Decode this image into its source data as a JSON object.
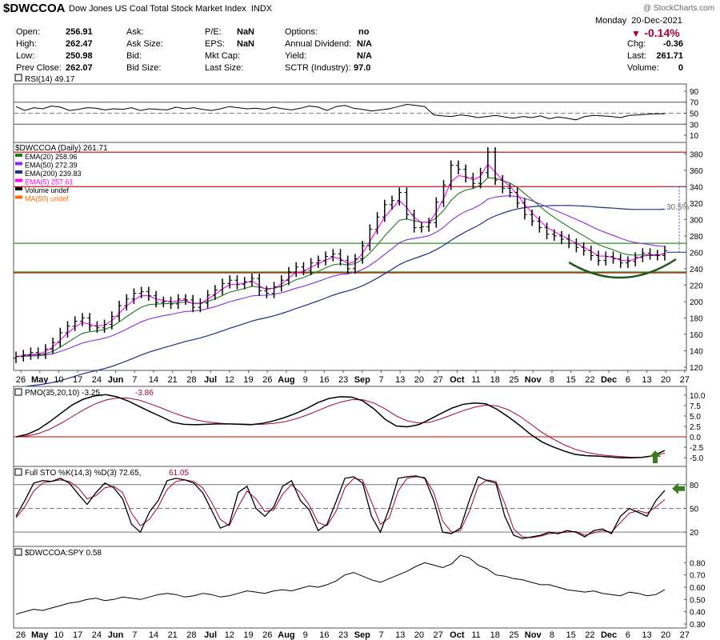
{
  "header": {
    "ticker": "$DWCCOA",
    "name": "Dow Jones US Coal Total Stock Market Index",
    "exchange": "INDX",
    "day": "Monday",
    "date": "20-Dec-2021",
    "pct_change": "-0.14%",
    "watermark": "@ StockCharts.com",
    "quote": {
      "open_label": "Open:",
      "open": "256.91",
      "high_label": "High:",
      "high": "262.47",
      "low_label": "Low:",
      "low": "250.98",
      "prev_label": "Prev Close:",
      "prev": "262.07",
      "ask_label": "Ask:",
      "ask_size_label": "Ask Size:",
      "bid_label": "Bid:",
      "bid_size_label": "Bid Size:",
      "pe_label": "P/E:",
      "pe": "NaN",
      "eps_label": "EPS:",
      "eps": "NaN",
      "mktcap_label": "Mkt Cap:",
      "lastsize_label": "Last Size:",
      "options_label": "Options:",
      "options": "no",
      "div_label": "Annual Dividend:",
      "div": "N/A",
      "yield_label": "Yield:",
      "yield": "N/A",
      "sctr_label": "SCTR (Industry):",
      "sctr": "97.0",
      "chg_label": "Chg:",
      "chg": "-0.36",
      "last_label": "Last:",
      "last": "261.71",
      "volume_label": "Volume:",
      "volume": "0"
    }
  },
  "chart_data": [
    {
      "type": "line",
      "panel": "rsi",
      "legend": "RSI(14) 49.17",
      "ylim": [
        0,
        100
      ],
      "ticks": [
        "90",
        "70",
        "50",
        "30",
        "10"
      ],
      "tick_values": [
        90,
        70,
        50,
        30,
        10
      ],
      "series": [
        {
          "name": "RSI(14)",
          "values": [
            62,
            55,
            60,
            58,
            63,
            61,
            55,
            57,
            60,
            59,
            56,
            58,
            57,
            60,
            55,
            58,
            57,
            56,
            61,
            58,
            60,
            57,
            55,
            58,
            62,
            60,
            58,
            59,
            57,
            61,
            58,
            56,
            59,
            63,
            61,
            55,
            62,
            64,
            59,
            57,
            54,
            56,
            58,
            62,
            66,
            64,
            62,
            47,
            45,
            44,
            47,
            45,
            42,
            44,
            46,
            43,
            41,
            44,
            42,
            45,
            40,
            43,
            41,
            38,
            44,
            46,
            45,
            44,
            42,
            46,
            47,
            48,
            49,
            49
          ]
        }
      ]
    },
    {
      "type": "candlestick",
      "panel": "price",
      "title": "$DWCCOA (Daily) 261.71",
      "ylim": [
        120,
        390
      ],
      "ticks": [
        "380",
        "360",
        "340",
        "320",
        "300",
        "280",
        "260",
        "240",
        "220",
        "200",
        "180",
        "160",
        "140",
        "120"
      ],
      "tick_values": [
        380,
        360,
        340,
        320,
        300,
        280,
        260,
        240,
        220,
        200,
        180,
        160,
        140,
        120
      ],
      "x_labels": [
        "26",
        "May",
        "10",
        "17",
        "24",
        "Jun",
        "7",
        "14",
        "21",
        "28",
        "Jul",
        "12",
        "19",
        "26",
        "Aug",
        "9",
        "16",
        "23",
        "Sep",
        "7",
        "13",
        "20",
        "27",
        "Oct",
        "11",
        "18",
        "25",
        "Nov",
        "8",
        "15",
        "22",
        "Dec",
        "6",
        "13",
        "20",
        "27"
      ],
      "x_label_weeks": [
        0,
        1,
        2,
        3,
        4,
        5,
        6,
        7,
        8,
        9,
        10,
        11,
        12,
        13,
        14,
        15,
        16,
        17,
        18,
        19,
        20,
        21,
        22,
        23,
        24,
        25,
        26,
        27,
        28,
        29,
        30,
        31,
        32,
        33,
        34,
        35
      ],
      "x_label_bold": [
        "May",
        "Jun",
        "Jul",
        "Aug",
        "Sep",
        "Oct",
        "Nov",
        "Dec"
      ],
      "close": [
        133,
        135,
        138,
        136,
        142,
        150,
        162,
        170,
        176,
        180,
        170,
        168,
        172,
        182,
        195,
        203,
        210,
        212,
        207,
        199,
        200,
        197,
        203,
        202,
        193,
        198,
        208,
        214,
        222,
        226,
        221,
        224,
        228,
        213,
        210,
        218,
        226,
        236,
        242,
        238,
        247,
        250,
        255,
        258,
        250,
        240,
        252,
        268,
        288,
        303,
        318,
        323,
        333,
        306,
        290,
        291,
        296,
        321,
        342,
        366,
        361,
        351,
        344,
        357,
        382,
        348,
        338,
        333,
        320,
        306,
        298,
        290,
        282,
        280,
        276,
        271,
        266,
        262,
        256,
        250,
        255,
        252,
        247,
        249,
        254,
        259,
        257,
        256,
        262
      ],
      "high_offset": 6,
      "low_offset": 6,
      "legend": [
        {
          "name": "EMA(20) 258.96",
          "color": "#1f7a1f"
        },
        {
          "name": "EMA(50) 272.39",
          "color": "#8a2be2"
        },
        {
          "name": "EMA(200) 239.83",
          "color": "#1f2f8a"
        },
        {
          "name": "EMA(5) 257.61",
          "color": "#ff00ff"
        },
        {
          "name": "Volume undef",
          "color": "#000000"
        },
        {
          "name": "MA(50) undef",
          "color": "#ff6a00"
        }
      ],
      "hlines": [
        {
          "value": 382,
          "color": "#cc0000"
        },
        {
          "value": 340,
          "color": "#cc0000"
        },
        {
          "value": 271,
          "color": "#cc0000"
        },
        {
          "value": 235,
          "color": "#cc0000"
        },
        {
          "value": 271,
          "color": "#1f9a1f"
        },
        {
          "value": 236,
          "color": "#1f9a1f"
        }
      ],
      "annotation": "30.5%",
      "projection": {
        "from": 260,
        "to": 340
      }
    },
    {
      "type": "line",
      "panel": "pmo",
      "legend_main": "PMO(35,20,10) -3.25,",
      "legend_signal": "-3.86",
      "ylim": [
        -6.5,
        11.5
      ],
      "ticks": [
        "10.0",
        "7.5",
        "5.0",
        "2.5",
        "0.0",
        "-2.5",
        "-5.0"
      ],
      "tick_values": [
        10,
        7.5,
        5,
        2.5,
        0,
        -2.5,
        -5
      ],
      "series": [
        {
          "name": "PMO",
          "color": "#000000",
          "values": [
            0,
            0.6,
            1.8,
            3.6,
            5.6,
            7.6,
            9,
            9.8,
            10.1,
            9.6,
            8.6,
            7.3,
            6,
            4.8,
            3.5,
            3,
            2.9,
            3,
            3.1,
            3.1,
            3,
            2.9,
            3.2,
            3.8,
            4.6,
            5.6,
            6.8,
            8.2,
            9.2,
            9.6,
            9.5,
            8.6,
            6.7,
            4.2,
            2.6,
            2.4,
            2.9,
            4.2,
            5.6,
            6.9,
            7.8,
            8.1,
            7.9,
            6.6,
            4.8,
            2.8,
            0.6,
            -1.2,
            -2.4,
            -3.4,
            -4.2,
            -4.5,
            -4.6,
            -4.8,
            -5.0,
            -5.0,
            -4.9,
            -4.5,
            -3.25
          ]
        },
        {
          "name": "Signal",
          "color": "#a8003a",
          "values": [
            0,
            0.2,
            0.8,
            1.8,
            3.2,
            4.8,
            6.4,
            7.8,
            8.8,
            9.3,
            9.3,
            8.8,
            7.9,
            6.9,
            5.8,
            4.9,
            4.1,
            3.6,
            3.3,
            3.1,
            3.1,
            3.0,
            3.0,
            3.2,
            3.6,
            4.3,
            5.2,
            6.3,
            7.4,
            8.3,
            8.9,
            8.9,
            8.1,
            6.7,
            5.0,
            3.8,
            3.3,
            3.5,
            4.3,
            5.3,
            6.3,
            7.1,
            7.6,
            7.4,
            6.5,
            5.0,
            3.1,
            1.1,
            -0.5,
            -1.9,
            -3.0,
            -3.7,
            -4.2,
            -4.5,
            -4.7,
            -4.9,
            -4.9,
            -4.6,
            -3.86
          ]
        }
      ],
      "hlines": [
        {
          "value": 0,
          "color": "#cc0000"
        }
      ]
    },
    {
      "type": "line",
      "panel": "sto",
      "legend_main": "Full STO %K(14,3) %D(3) 72.65,",
      "legend_signal": "61.05",
      "ylim": [
        5,
        100
      ],
      "ticks": [
        "80",
        "50",
        "20"
      ],
      "tick_values": [
        80,
        50,
        20
      ],
      "series": [
        {
          "name": "%K",
          "color": "#000000",
          "values": [
            40,
            60,
            82,
            85,
            84,
            88,
            82,
            68,
            55,
            70,
            82,
            76,
            62,
            30,
            20,
            45,
            60,
            85,
            88,
            86,
            82,
            70,
            48,
            25,
            30,
            70,
            78,
            50,
            40,
            52,
            78,
            85,
            60,
            48,
            22,
            30,
            58,
            88,
            90,
            82,
            40,
            20,
            50,
            88,
            90,
            91,
            88,
            60,
            20,
            18,
            25,
            60,
            90,
            85,
            82,
            40,
            16,
            12,
            14,
            16,
            20,
            18,
            22,
            20,
            14,
            22,
            24,
            18,
            40,
            50,
            45,
            40,
            60,
            72.65
          ]
        },
        {
          "name": "%D",
          "color": "#a8003a",
          "values": [
            38,
            52,
            72,
            82,
            84,
            86,
            84,
            76,
            62,
            66,
            76,
            78,
            70,
            44,
            28,
            36,
            52,
            74,
            84,
            86,
            84,
            76,
            58,
            36,
            28,
            52,
            72,
            62,
            46,
            48,
            68,
            80,
            70,
            54,
            32,
            28,
            46,
            76,
            88,
            86,
            58,
            30,
            38,
            72,
            88,
            90,
            89,
            70,
            34,
            20,
            22,
            46,
            78,
            86,
            84,
            56,
            24,
            14,
            13,
            15,
            18,
            19,
            20,
            21,
            16,
            19,
            22,
            20,
            32,
            44,
            47,
            44,
            52,
            61.05
          ]
        }
      ],
      "hlines": [
        {
          "value": 80
        },
        {
          "value": 50
        },
        {
          "value": 20
        }
      ]
    },
    {
      "type": "line",
      "panel": "relative",
      "legend": "$DWCCOA:SPY 0.58",
      "ylim": [
        0.28,
        0.92
      ],
      "ticks": [
        "0.80",
        "0.70",
        "0.60",
        "0.50",
        "0.40",
        "0.30"
      ],
      "tick_values": [
        0.8,
        0.7,
        0.6,
        0.5,
        0.4,
        0.3
      ],
      "series": [
        {
          "name": "$DWCCOA:SPY",
          "values": [
            0.38,
            0.4,
            0.42,
            0.41,
            0.43,
            0.45,
            0.47,
            0.48,
            0.5,
            0.51,
            0.49,
            0.5,
            0.52,
            0.51,
            0.5,
            0.52,
            0.54,
            0.55,
            0.54,
            0.52,
            0.53,
            0.55,
            0.54,
            0.52,
            0.53,
            0.55,
            0.57,
            0.56,
            0.55,
            0.57,
            0.58,
            0.57,
            0.59,
            0.61,
            0.6,
            0.62,
            0.65,
            0.7,
            0.72,
            0.69,
            0.66,
            0.64,
            0.67,
            0.7,
            0.73,
            0.77,
            0.8,
            0.78,
            0.76,
            0.79,
            0.86,
            0.84,
            0.78,
            0.75,
            0.7,
            0.69,
            0.67,
            0.66,
            0.64,
            0.62,
            0.62,
            0.6,
            0.58,
            0.57,
            0.56,
            0.57,
            0.55,
            0.54,
            0.53,
            0.56,
            0.55,
            0.53,
            0.54,
            0.58
          ]
        }
      ]
    }
  ]
}
